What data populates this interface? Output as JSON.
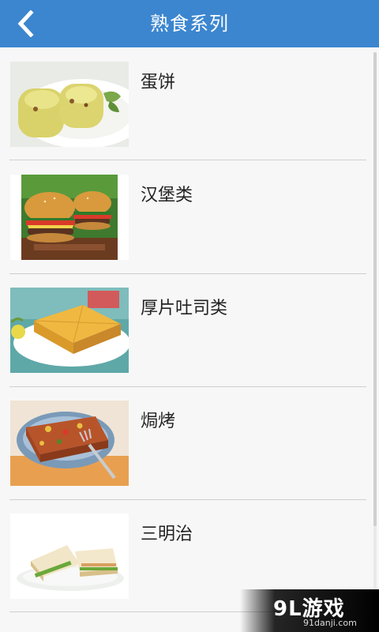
{
  "header": {
    "title": "熟食系列",
    "back_icon": "chevron-left-icon"
  },
  "colors": {
    "header_bg": "#3b86cf",
    "list_bg": "#f7f7f7",
    "divider": "#cfcfcf"
  },
  "items": [
    {
      "label": "蛋饼",
      "image": "egg-pancake-roll"
    },
    {
      "label": "汉堡类",
      "image": "hamburgers"
    },
    {
      "label": "厚片吐司类",
      "image": "thick-toast"
    },
    {
      "label": "焗烤",
      "image": "baked-toast"
    },
    {
      "label": "三明治",
      "image": "sandwich"
    }
  ],
  "watermark": {
    "main": "9L游戏",
    "sub": "91danji.com"
  }
}
